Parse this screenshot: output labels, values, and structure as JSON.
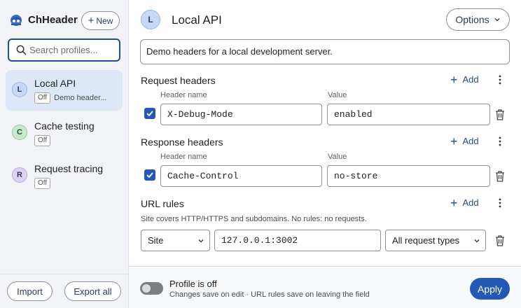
{
  "app": {
    "name": "ChHeader"
  },
  "sidebar": {
    "new_label": "New",
    "search_placeholder": "Search profiles...",
    "profiles": [
      {
        "initial": "L",
        "name": "Local API",
        "badge": "Off",
        "description": "Demo header...",
        "active": true
      },
      {
        "initial": "C",
        "name": "Cache testing",
        "badge": "Off"
      },
      {
        "initial": "R",
        "name": "Request tracing",
        "badge": "Off"
      }
    ],
    "import_label": "Import",
    "export_label": "Export all"
  },
  "main": {
    "avatar_initial": "L",
    "title": "Local API",
    "options_label": "Options",
    "description": "Demo headers for a local development server.",
    "request_headers": {
      "title": "Request headers",
      "add_label": "Add",
      "col_name": "Header name",
      "col_value": "Value",
      "rows": [
        {
          "name": "X-Debug-Mode",
          "value": "enabled",
          "checked": true
        }
      ]
    },
    "response_headers": {
      "title": "Response headers",
      "add_label": "Add",
      "col_name": "Header name",
      "col_value": "Value",
      "rows": [
        {
          "name": "Cache-Control",
          "value": "no-store",
          "checked": true
        }
      ]
    },
    "url_rules": {
      "title": "URL rules",
      "add_label": "Add",
      "note": "Site covers HTTP/HTTPS and subdomains. No rules: no requests.",
      "rows": [
        {
          "match_type": "Site",
          "pattern": "127.0.0.1:3002",
          "request_types": "All request types"
        }
      ]
    }
  },
  "footer": {
    "status": "Profile is off",
    "hint": "Changes save on edit · URL rules save on leaving the field",
    "apply_label": "Apply"
  },
  "colors": {
    "accent": "#2358b4",
    "sidebar_bg": "#f1f3f6",
    "active_item_bg": "#dde7f7"
  }
}
